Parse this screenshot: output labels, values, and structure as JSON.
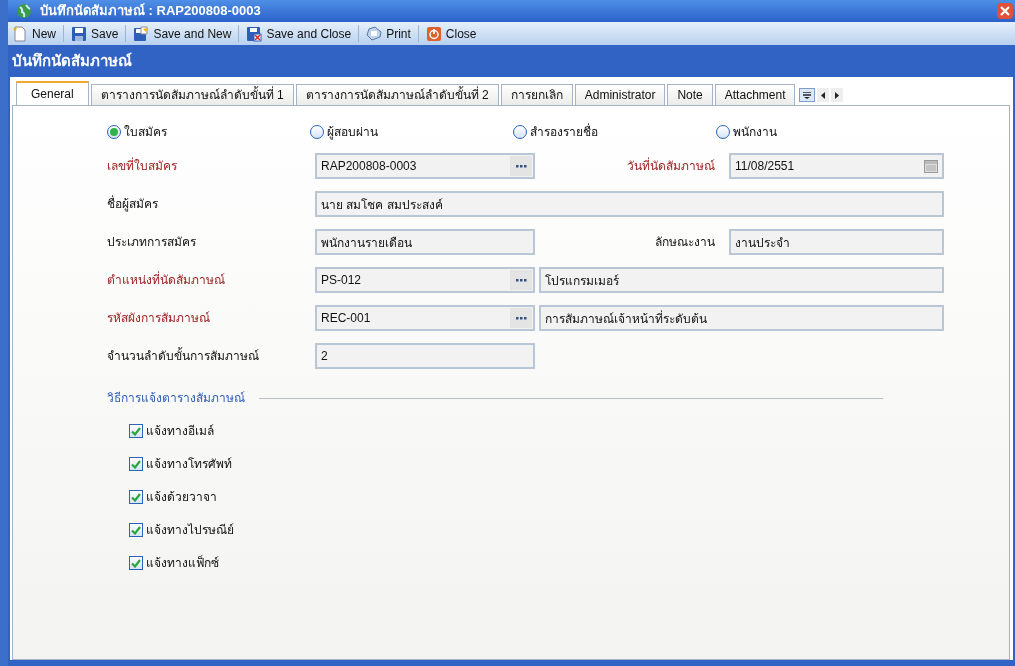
{
  "window": {
    "title": "บันทึกนัดสัมภาษณ์ : RAP200808-0003"
  },
  "toolbar": [
    {
      "kind": "new",
      "label": "New"
    },
    {
      "kind": "save",
      "label": "Save"
    },
    {
      "kind": "save_new",
      "label": "Save and New"
    },
    {
      "kind": "save_close",
      "label": "Save and Close"
    },
    {
      "kind": "print",
      "label": "Print"
    },
    {
      "kind": "close",
      "label": "Close"
    }
  ],
  "header": "บันทึกนัดสัมภาษณ์",
  "tabs": [
    {
      "label": "General",
      "selected": true
    },
    {
      "label": "ตารางการนัดสัมภาษณ์ลำดับขั้นที่ 1",
      "selected": false
    },
    {
      "label": "ตารางการนัดสัมภาษณ์ลำดับขั้นที่ 2",
      "selected": false
    },
    {
      "label": "การยกเลิก",
      "selected": false
    },
    {
      "label": "Administrator",
      "selected": false
    },
    {
      "label": "Note",
      "selected": false
    },
    {
      "label": "Attachment",
      "selected": false
    }
  ],
  "radios": [
    {
      "label": "ใบสมัคร",
      "selected": true
    },
    {
      "label": "ผู้สอบผ่าน",
      "selected": false
    },
    {
      "label": "สำรองรายชื่อ",
      "selected": false
    },
    {
      "label": "พนักงาน",
      "selected": false
    }
  ],
  "form_rows": [
    {
      "items": [
        {
          "kind": "label",
          "text": "เลขที่ใบสมัคร",
          "required": true
        },
        {
          "kind": "lookup",
          "value": "RAP200808-0003"
        },
        {
          "kind": "label",
          "text": "วันที่นัดสัมภาษณ์",
          "required": true
        },
        {
          "kind": "date",
          "value": "11/08/2551"
        }
      ]
    },
    {
      "items": [
        {
          "kind": "label",
          "text": "ชื่อผู้สมัคร",
          "required": false
        },
        {
          "kind": "long_text",
          "value": "นาย สมโชค สมประสงค์"
        }
      ]
    },
    {
      "items": [
        {
          "kind": "label",
          "text": "ประเภทการสมัคร",
          "required": false
        },
        {
          "kind": "text",
          "value": "พนักงานรายเดือน"
        },
        {
          "kind": "label",
          "text": "ลักษณะงาน",
          "required": false
        },
        {
          "kind": "text",
          "value": "งานประจำ"
        }
      ]
    },
    {
      "items": [
        {
          "kind": "label",
          "text": "ตำแหน่งที่นัดสัมภาษณ์",
          "required": true
        },
        {
          "kind": "lookup",
          "value": "PS-012"
        },
        {
          "kind": "description",
          "value": "โปรแกรมเมอร์"
        }
      ]
    },
    {
      "items": [
        {
          "kind": "label",
          "text": "รหัสผังการสัมภาษณ์",
          "required": true
        },
        {
          "kind": "lookup",
          "value": "REC-001"
        },
        {
          "kind": "description",
          "value": "การสัมภาษณ์เจ้าหน้าที่ระดับต้น"
        }
      ]
    },
    {
      "items": [
        {
          "kind": "label",
          "text": "จำนวนลำดับขั้นการสัมภาษณ์",
          "required": false
        },
        {
          "kind": "text",
          "value": "2"
        }
      ]
    }
  ],
  "notify_section": {
    "title": "วิธีการแจ้งตารางสัมภาษณ์",
    "options": [
      {
        "label": "แจ้งทางอีเมล์",
        "checked": true
      },
      {
        "label": "แจ้งทางโทรศัพท์",
        "checked": true
      },
      {
        "label": "แจ้งด้วยวาจา",
        "checked": true
      },
      {
        "label": "แจ้งทางไปรษณีย์",
        "checked": true
      },
      {
        "label": "แจ้งทางแฟ็กซ์",
        "checked": true
      }
    ]
  }
}
